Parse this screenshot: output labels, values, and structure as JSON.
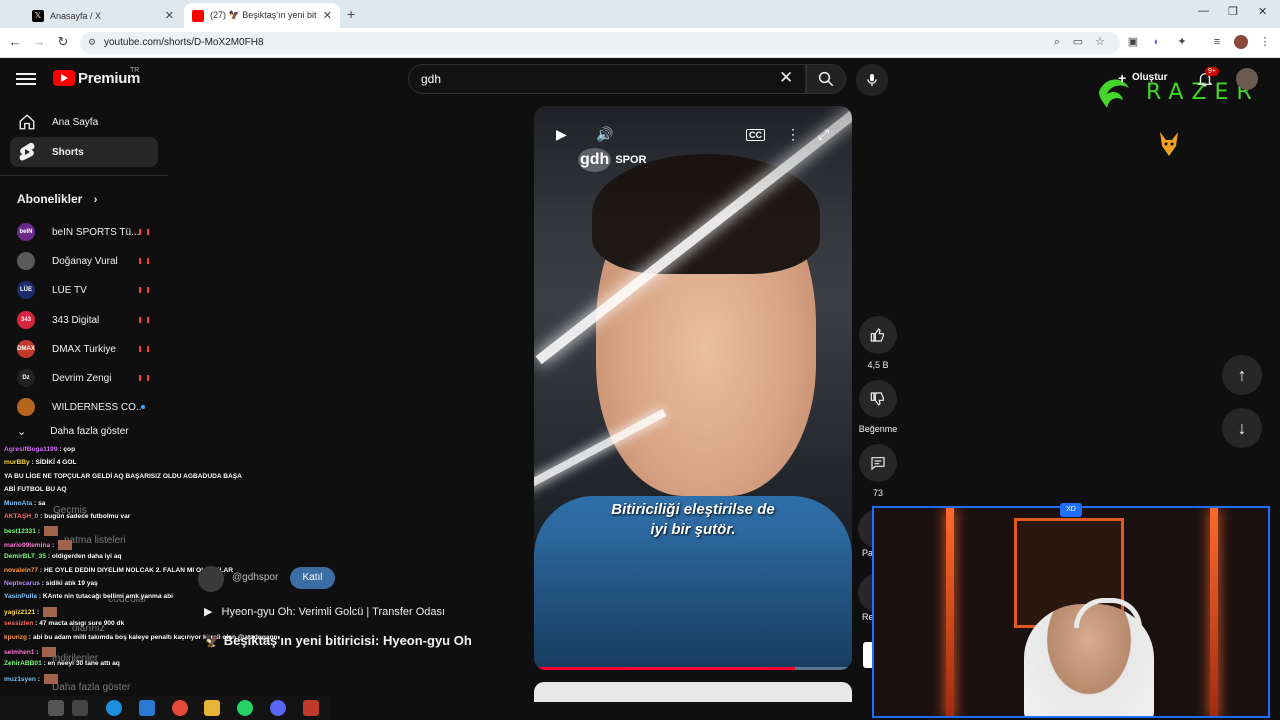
{
  "browser": {
    "tabs": [
      {
        "title": "Anasayfa / X",
        "icon": "x-logo-icon"
      },
      {
        "title": "(27) 🦅 Beşiktaş'ın yeni bitirici",
        "icon": "youtube-icon"
      }
    ],
    "url": "youtube.com/shorts/D-MoX2M0FH8"
  },
  "header": {
    "brand": "Premium",
    "region": "TR",
    "search_value": "gdh",
    "create_label": "Oluştur",
    "notifications_badge": "9+"
  },
  "sidebar": {
    "items": [
      {
        "label": "Ana Sayfa",
        "icon": "home-icon"
      },
      {
        "label": "Shorts",
        "icon": "shorts-icon"
      }
    ],
    "subscriptions_title": "Abonelikler",
    "subscriptions": [
      {
        "name": "beIN SPORTS Tü...",
        "avatar_text": "beIN",
        "color": "#6b2a8a"
      },
      {
        "name": "Doğanay Vural",
        "avatar_text": "",
        "color": "#5a5a5a"
      },
      {
        "name": "LÜE TV",
        "avatar_text": "LÜE",
        "color": "#1d2d6b"
      },
      {
        "name": "343 Digital",
        "avatar_text": "343",
        "color": "#d7263d"
      },
      {
        "name": "DMAX Turkiye",
        "avatar_text": "DMAX",
        "color": "#c0392b"
      },
      {
        "name": "Devrim Zengi",
        "avatar_text": "Dz",
        "color": "#222222"
      },
      {
        "name": "WILDERNESS CO...",
        "avatar_text": "",
        "color": "#b5651d"
      }
    ],
    "more_label": "Daha fazla göster",
    "ghost": {
      "history": "Geçmiş",
      "playlists": "natma listeleri",
      "my_videos": "eodeolar",
      "lists": "olarınız",
      "downloads": "İndirilenler",
      "more": "Daha fazla göster"
    }
  },
  "chat": [
    {
      "user": "AgresifBoga1199",
      "msg": "çop",
      "ucolor": "#d76bff"
    },
    {
      "user": "murBBy",
      "msg": "SİDİKİ 4 GOL",
      "ucolor": "#ffd84d"
    },
    {
      "user": "",
      "msg": "YA BU LİGE NE TOPÇULAR GELDİ AQ BAŞARISIZ OLDU AGBADUDA BAŞA",
      "ucolor": "#ffffff"
    },
    {
      "user": "",
      "msg": "ABİ FUTBOL BU AQ",
      "ucolor": "#ffffff"
    },
    {
      "user": "MunoAta",
      "msg": "sa",
      "ucolor": "#7ac6ff"
    },
    {
      "user": "AKTAŞH_0",
      "msg": "bugün sadece futbolmu var",
      "ucolor": "#ff6b6b"
    },
    {
      "user": "best12331",
      "msg": "",
      "ucolor": "#7cff7c"
    },
    {
      "user": "mario99lemina",
      "msg": "",
      "ucolor": "#ff7ad9"
    },
    {
      "user": "DemirBLT_35",
      "msg": "oldigerden daha iyi aq",
      "ucolor": "#7cff7c"
    },
    {
      "user": "novalein77",
      "msg": "HE OYLE DEDIN DIYELIM NOLCAK 2. FALAN MI OLCAKLAR",
      "ucolor": "#ff9a3c"
    },
    {
      "user": "Neptecarus",
      "msg": "sidiki atık 19 yaş",
      "ucolor": "#b48cff"
    },
    {
      "user": "YasinPulla",
      "msg": "KAnte nin tutacağı bellimi amk yanma abi",
      "ucolor": "#7ac6ff"
    },
    {
      "user": "yagiz2121",
      "msg": "",
      "ucolor": "#ffd84d"
    },
    {
      "user": "sessizlen",
      "msg": "47 macta alsıgı sure 900 dk",
      "ucolor": "#ff6b6b"
    },
    {
      "user": "kpunzg",
      "msg": "abi bu adam milli takımda boş kaleye penaltı kaçırıyor koreli olan @atadogann",
      "ucolor": "#ff9a3c"
    },
    {
      "user": "seimhen1",
      "msg": "",
      "ucolor": "#ff7ad9"
    },
    {
      "user": "ZehirABB01",
      "msg": "en neeyi 30 tane attı aq",
      "ucolor": "#7cff7c"
    },
    {
      "user": "muz1syen",
      "msg": "",
      "ucolor": "#7ac6ff"
    }
  ],
  "video": {
    "watermark_logo": "gdh",
    "watermark_text": "SPOR",
    "subtitle_line1": "Bitiriciliği eleştirilse de",
    "subtitle_line2": "iyi bir şutör.",
    "progress": 0.82,
    "channel": "@gdhspor",
    "join_label": "Katıl",
    "song": "Hyeon-gyu Oh: Verimli Golcü | Transfer Odası",
    "title": "🦅 Beşiktaş'ın yeni bitiricisi: Hyeon-gyu Oh"
  },
  "actions": {
    "likes": "4,5 B",
    "dislike_label": "Beğenme",
    "comments": "73",
    "share_label": "Pa",
    "remix_label": "Re"
  },
  "overlay": {
    "razer": "RAZER",
    "cam_badge": "XD"
  },
  "colors": {
    "accent": "#ff0000",
    "razer_green": "#44d62c",
    "cam_border": "#1f6fff"
  }
}
